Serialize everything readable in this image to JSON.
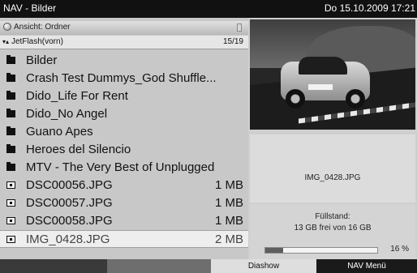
{
  "titlebar": {
    "title": "NAV - Bilder",
    "datetime": "Do 15.10.2009  17:21"
  },
  "view_bar": {
    "label": "Ansicht: Ordner",
    "icon": "disc-icon"
  },
  "path_bar": {
    "path": "JetFlash(vorn)",
    "position": "15/19"
  },
  "files": [
    {
      "type": "folder",
      "name": "Bilder",
      "size": ""
    },
    {
      "type": "folder",
      "name": "Crash Test Dummys_God Shuffle...",
      "size": ""
    },
    {
      "type": "folder",
      "name": "Dido_Life For Rent",
      "size": ""
    },
    {
      "type": "folder",
      "name": "Dido_No Angel",
      "size": ""
    },
    {
      "type": "folder",
      "name": "Guano Apes",
      "size": ""
    },
    {
      "type": "folder",
      "name": "Heroes del Silencio",
      "size": ""
    },
    {
      "type": "folder",
      "name": "MTV - The Very Best of Unplugged",
      "size": ""
    },
    {
      "type": "image",
      "name": "DSC00056.JPG",
      "size": "1 MB"
    },
    {
      "type": "image",
      "name": "DSC00057.JPG",
      "size": "1 MB"
    },
    {
      "type": "image",
      "name": "DSC00058.JPG",
      "size": "1 MB"
    },
    {
      "type": "image",
      "name": "IMG_0428.JPG",
      "size": "2 MB",
      "selected": true
    }
  ],
  "preview": {
    "filename": "IMG_0428.JPG"
  },
  "storage": {
    "label": "Füllstand:",
    "free_text": "13 GB frei von 16 GB",
    "percent_label": "16 %",
    "fill_fraction": 0.16
  },
  "function_keys": {
    "red": "",
    "green": "",
    "yellow": "Diashow",
    "blue": "NAV Menü"
  },
  "colors": {
    "titlebar_bg": "#111111",
    "panel_bg": "#c8c8c8",
    "selected_row_bg": "#eeeeee"
  }
}
